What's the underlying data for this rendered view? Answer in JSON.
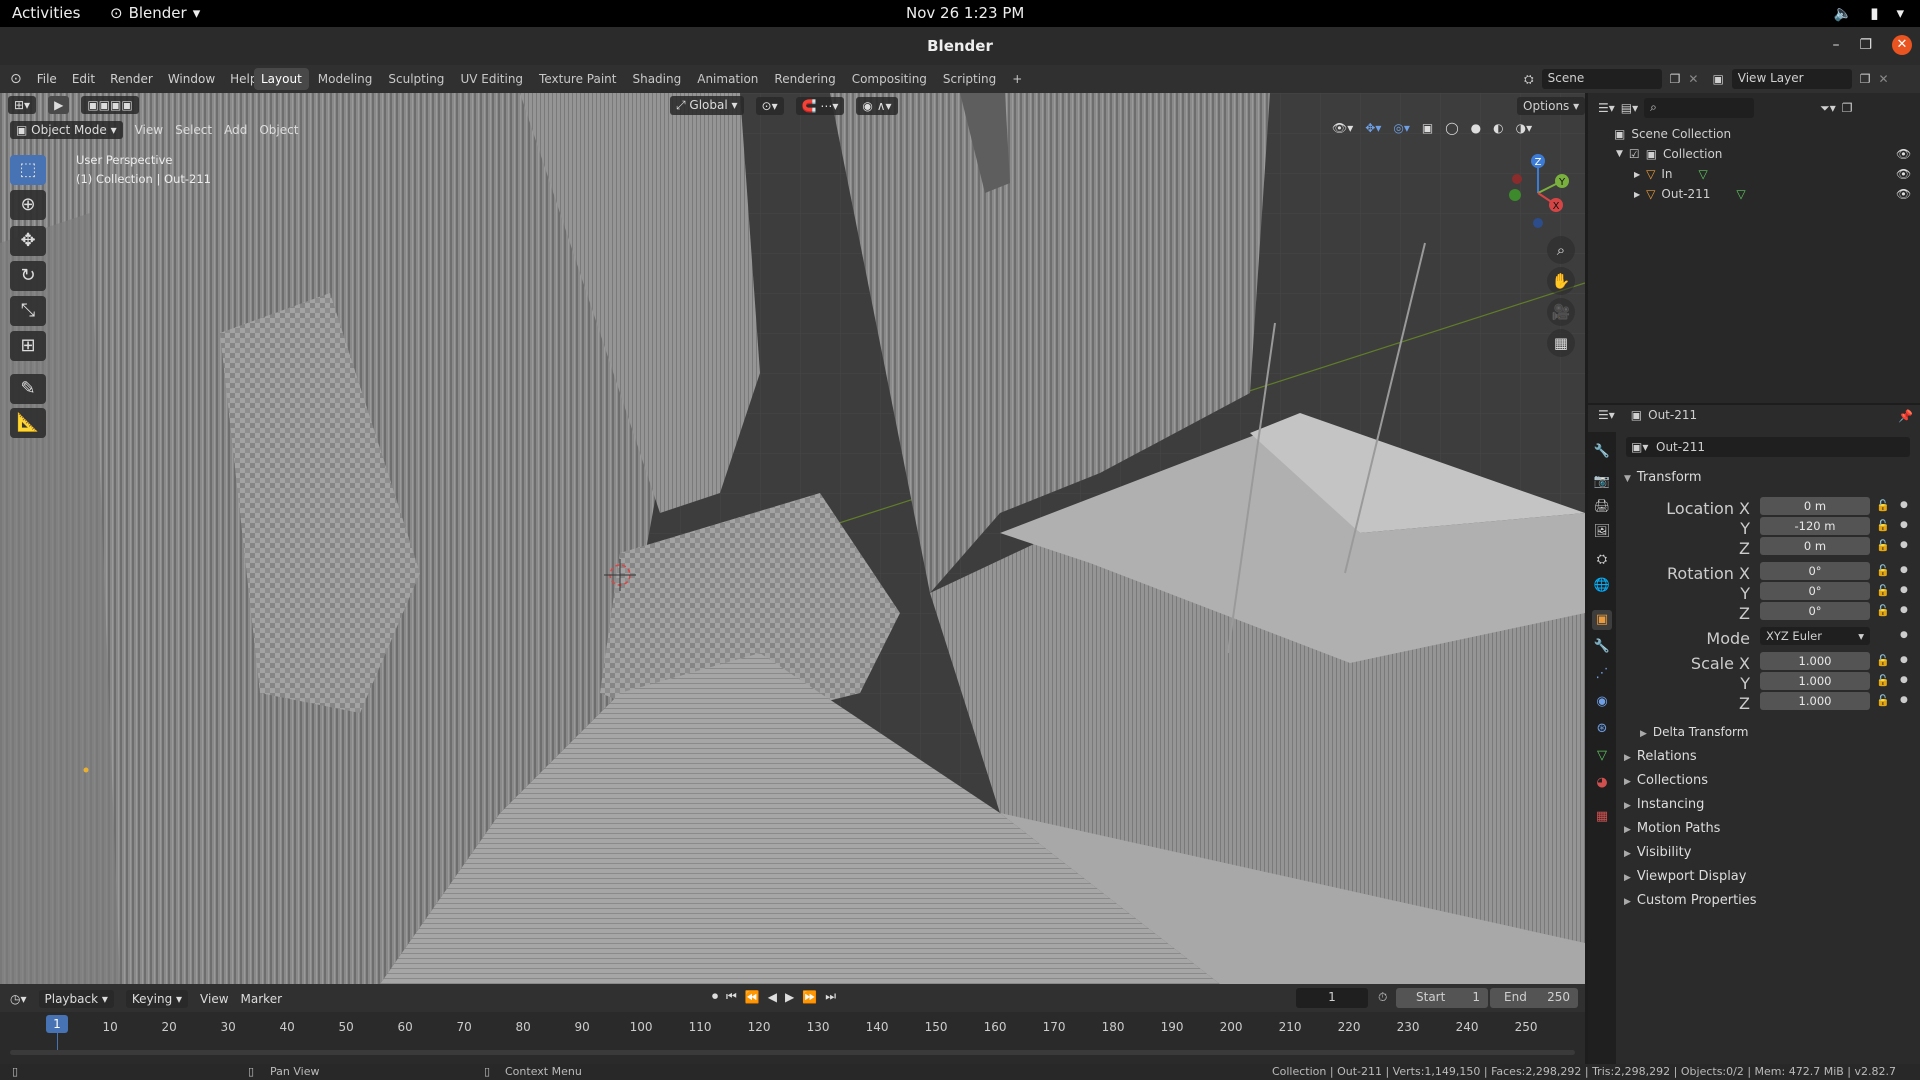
{
  "system": {
    "activities": "Activities",
    "app_name": "Blender",
    "clock": "Nov 26  1:23 PM"
  },
  "window": {
    "title": "Blender"
  },
  "menu": [
    "File",
    "Edit",
    "Render",
    "Window",
    "Help"
  ],
  "workspaces": [
    "Layout",
    "Modeling",
    "Sculpting",
    "UV Editing",
    "Texture Paint",
    "Shading",
    "Animation",
    "Rendering",
    "Compositing",
    "Scripting"
  ],
  "active_workspace": "Layout",
  "scene": {
    "scene_name": "Scene",
    "view_layer": "View Layer"
  },
  "viewport_header": {
    "orientation": "Global",
    "options": "Options",
    "mode": "Object Mode",
    "menus": [
      "View",
      "Select",
      "Add",
      "Object"
    ]
  },
  "viewport": {
    "perspective": "User Perspective",
    "collection_info": "(1) Collection | Out-211"
  },
  "gizmo": {
    "z": "Z",
    "y": "Y",
    "x": "X"
  },
  "outliner": {
    "scene_collection": "Scene Collection",
    "collection": "Collection",
    "objects": [
      "In",
      "Out-211"
    ]
  },
  "properties": {
    "object_name": "Out-211",
    "datablock_name": "Out-211",
    "transform_title": "Transform",
    "location_x_label": "Location X",
    "rotation_x_label": "Rotation X",
    "scale_x_label": "Scale X",
    "axis_y": "Y",
    "axis_z": "Z",
    "mode_label": "Mode",
    "location": [
      "0 m",
      "-120 m",
      "0 m"
    ],
    "rotation": [
      "0°",
      "0°",
      "0°"
    ],
    "mode": "XYZ Euler",
    "scale": [
      "1.000",
      "1.000",
      "1.000"
    ],
    "delta_transform": "Delta Transform",
    "panels": [
      "Relations",
      "Collections",
      "Instancing",
      "Motion Paths",
      "Visibility",
      "Viewport Display",
      "Custom Properties"
    ]
  },
  "timeline": {
    "menus": [
      "Playback",
      "Keying",
      "View",
      "Marker"
    ],
    "current_frame": "1",
    "start_label": "Start",
    "start": "1",
    "end_label": "End",
    "end": "250",
    "ticks": [
      "1",
      "10",
      "20",
      "30",
      "40",
      "50",
      "60",
      "70",
      "80",
      "90",
      "100",
      "110",
      "120",
      "130",
      "140",
      "150",
      "160",
      "170",
      "180",
      "190",
      "200",
      "210",
      "220",
      "230",
      "240",
      "250"
    ]
  },
  "statusbar": {
    "pan": "Pan View",
    "context": "Context Menu",
    "stats": "Collection | Out-211 | Verts:1,149,150 | Faces:2,298,292 | Tris:2,298,292 | Objects:0/2 | Mem: 472.7 MiB | v2.82.7"
  }
}
